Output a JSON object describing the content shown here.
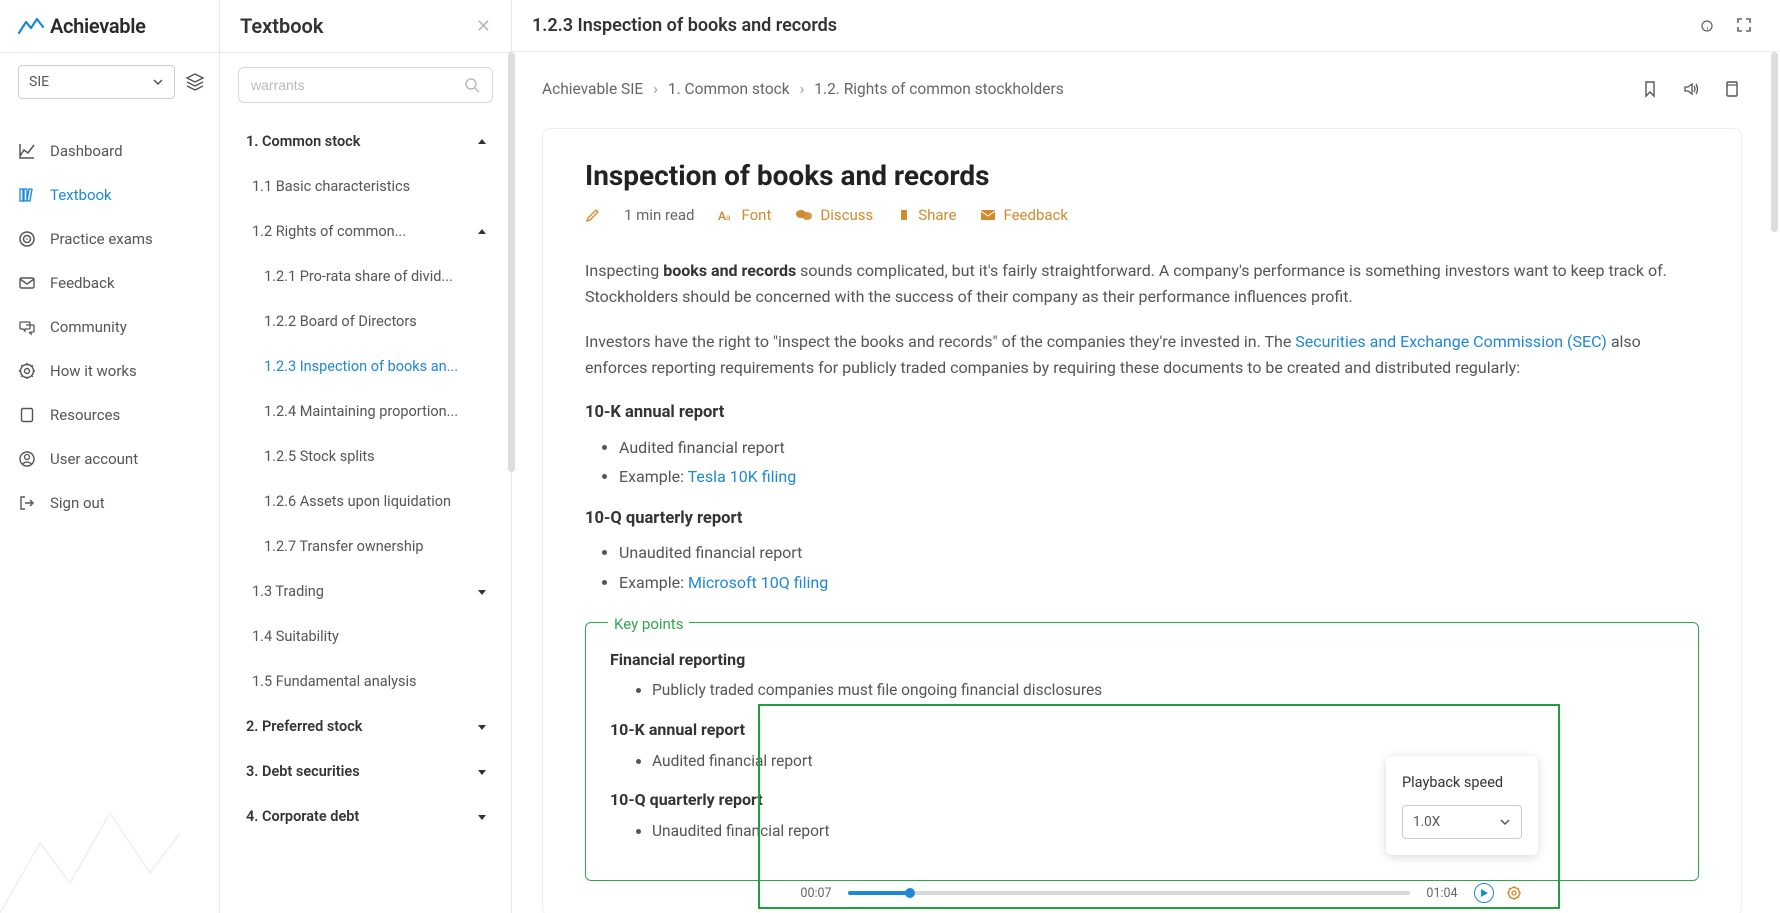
{
  "brand": "Achievable",
  "course_selector": {
    "value": "SIE"
  },
  "nav": [
    {
      "id": "dashboard",
      "label": "Dashboard"
    },
    {
      "id": "textbook",
      "label": "Textbook"
    },
    {
      "id": "practice",
      "label": "Practice exams"
    },
    {
      "id": "feedback",
      "label": "Feedback"
    },
    {
      "id": "community",
      "label": "Community"
    },
    {
      "id": "howitworks",
      "label": "How it works"
    },
    {
      "id": "resources",
      "label": "Resources"
    },
    {
      "id": "useraccount",
      "label": "User account"
    },
    {
      "id": "signout",
      "label": "Sign out"
    }
  ],
  "tree": {
    "title": "Textbook",
    "search_placeholder": "warrants",
    "items": [
      {
        "label": "1. Common stock",
        "bold": true,
        "expand": "up"
      },
      {
        "label": "1.1 Basic characteristics",
        "sub": 1
      },
      {
        "label": "1.2 Rights of common...",
        "sub": 1,
        "expand": "up"
      },
      {
        "label": "1.2.1 Pro-rata share of divid...",
        "sub": 2
      },
      {
        "label": "1.2.2 Board of Directors",
        "sub": 2
      },
      {
        "label": "1.2.3 Inspection of books an...",
        "sub": 2,
        "active": true
      },
      {
        "label": "1.2.4 Maintaining proportion...",
        "sub": 2
      },
      {
        "label": "1.2.5 Stock splits",
        "sub": 2
      },
      {
        "label": "1.2.6 Assets upon liquidation",
        "sub": 2
      },
      {
        "label": "1.2.7 Transfer ownership",
        "sub": 2
      },
      {
        "label": "1.3 Trading",
        "sub": 1,
        "expand": "down"
      },
      {
        "label": "1.4 Suitability",
        "sub": 1
      },
      {
        "label": "1.5 Fundamental analysis",
        "sub": 1
      },
      {
        "label": "2. Preferred stock",
        "bold": true,
        "expand": "down"
      },
      {
        "label": "3. Debt securities",
        "bold": true,
        "expand": "down"
      },
      {
        "label": "4. Corporate debt",
        "bold": true,
        "expand": "down"
      }
    ]
  },
  "header": {
    "title": "1.2.3 Inspection of books and records"
  },
  "breadcrumb": [
    "Achievable SIE",
    "1. Common stock",
    "1.2. Rights of common stockholders"
  ],
  "article": {
    "title": "Inspection of books and records",
    "read_time": "1 min read",
    "meta_links": {
      "font": "Font",
      "discuss": "Discuss",
      "share": "Share",
      "feedback": "Feedback"
    },
    "para1_pre": "Inspecting ",
    "para1_bold": "books and records",
    "para1_post": " sounds complicated, but it's fairly straightforward. A company's performance is something investors want to keep track of. Stockholders should be concerned with the success of their company as their performance influences profit.",
    "para2_pre": "Investors have the right to \"inspect the books and records\" of the companies they're invested in. The ",
    "para2_link": "Securities and Exchange Commission (SEC)",
    "para2_post": " also enforces reporting requirements for publicly traded companies by requiring these documents to be created and distributed regularly:",
    "sec10k": {
      "title": "10-K annual report",
      "b1": "Audited financial report",
      "b2_pre": "Example: ",
      "b2_link": "Tesla 10K filing"
    },
    "sec10q": {
      "title": "10-Q quarterly report",
      "b1": "Unaudited financial report",
      "b2_pre": "Example: ",
      "b2_link": "Microsoft 10Q filing"
    },
    "keypoints": {
      "legend": "Key points",
      "fr_title": "Financial reporting",
      "fr_b1": "Publicly traded companies must file ongoing financial disclosures",
      "k10_title": "10-K annual report",
      "k10_b1": "Audited financial report",
      "q10_title": "10-Q quarterly report",
      "q10_b1": "Unaudited financial report"
    }
  },
  "audio": {
    "current": "00:07",
    "total": "01:04",
    "popup_title": "Playback speed",
    "speed": "1.0X"
  }
}
